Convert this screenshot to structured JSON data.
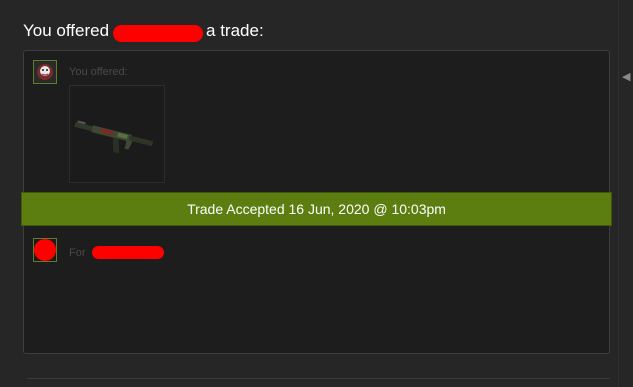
{
  "header": {
    "prefix": "You offered",
    "suffix": "a trade:"
  },
  "offer_section": {
    "label": "You offered:",
    "item_icon": "ak47-rifle-icon"
  },
  "status_banner": {
    "text": "Trade Accepted 16 Jun, 2020 @ 10:03pm",
    "color": "#5c7e10"
  },
  "receive_section": {
    "label_prefix": "For"
  },
  "colors": {
    "background": "#262626",
    "panel": "#1d1d1d",
    "redaction": "#ff0000",
    "avatar_border": "#5b7e2c"
  }
}
